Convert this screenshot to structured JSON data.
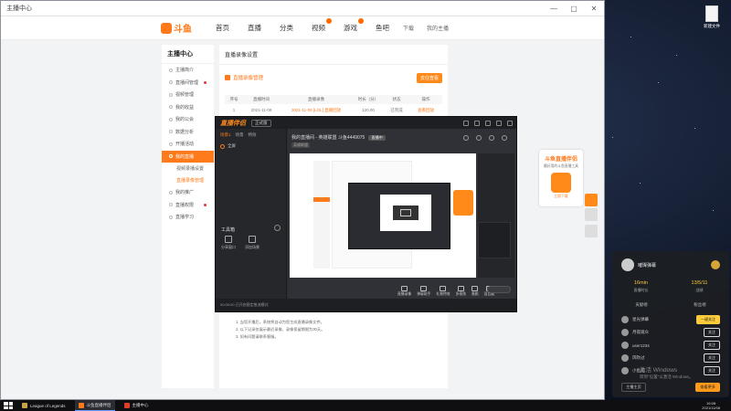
{
  "browser": {
    "title": "主播中心"
  },
  "site": {
    "logo": "斗鱼",
    "nav": [
      "首页",
      "直播",
      "分类",
      "视频",
      "游戏",
      "鱼吧"
    ],
    "header_right": [
      "下载",
      "我的主播"
    ]
  },
  "sidebar": {
    "title": "主播中心",
    "items": [
      "主播简介",
      "直播间管理",
      "视频管理",
      "我的收益",
      "我的公会",
      "数据分析",
      "开播活动",
      "我的直播"
    ],
    "subitems": [
      "视频录播设置",
      "直播录像管理"
    ],
    "items_after": [
      "我的推广",
      "直播权限",
      "直播学习"
    ]
  },
  "main": {
    "title": "直播录像设置",
    "tag": "直播录像管理",
    "action": "去往查看",
    "columns": [
      "序号",
      "直播时间",
      "直播录像",
      "时长（分）",
      "状态",
      "操作"
    ],
    "rows": [
      {
        "idx": "1",
        "time": "2021-11-08",
        "title": "2021-11-08 [LOL] 直播回放",
        "duration": "120.00",
        "status": "已完成",
        "op": "查看回放"
      }
    ],
    "notes": [
      "1. 当您开播后，系统将自动为您生成直播录像文件。",
      "2. 以下记录仅展示最近录像，录像保留期限为30天。",
      "3. 如有问题请联系客服。"
    ]
  },
  "app": {
    "brand": "直播伴侣",
    "version": "正式版",
    "tabs": [
      "场景1",
      "场景",
      "特效"
    ],
    "scene": "全屏",
    "layer_label": "工具箱",
    "source_buttons": [
      "分享窗口",
      "添加场景"
    ],
    "room_title": "我的直播间 - 英雄联盟 斗鱼4449075",
    "room_tag": "直播中",
    "room_sub_tag": "英雄联盟",
    "tools": [
      "直播录像",
      "弹幕助手",
      "礼物特效",
      "多视角",
      "美颜",
      "混音器"
    ],
    "status": "00:00:00 已开启稳定推流模式"
  },
  "ad": {
    "title": "斗鱼直播伴侣",
    "subtitle": "最好用的斗鱼直播工具",
    "cta": "立即下载"
  },
  "chat": {
    "name": "璀璨弹幕",
    "stats": [
      {
        "value": "16min",
        "label": "直播时长"
      },
      {
        "value": "13/5/11",
        "label": "战绩"
      }
    ],
    "tabs": [
      "贡献榜",
      "粉丝榜"
    ],
    "users": [
      {
        "name": "星光弹幕",
        "score": "",
        "btn": "一键关注",
        "hot": true
      },
      {
        "name": "月夜观众",
        "score": "",
        "btn": "关注",
        "hot": false
      },
      {
        "name": "user1234",
        "score": "",
        "btn": "关注",
        "hot": false
      },
      {
        "name": "风吹过",
        "score": "",
        "btn": "关注",
        "hot": false
      },
      {
        "name": "小鱼儿",
        "score": "",
        "btn": "关注",
        "hot": false
      }
    ],
    "footer": [
      "主播主页",
      "查看更多"
    ]
  },
  "desktop": {
    "icons": [
      "斗鱼",
      "新建文件"
    ],
    "overlay_logo": "斗鱼",
    "overlay_number": "4449075"
  },
  "watermark": {
    "title": "激活 Windows",
    "sub": "转到\"设置\"以激活 Windows。"
  },
  "taskbar": {
    "tasks": [
      {
        "label": "League of Legends",
        "color": "#c8a24a"
      },
      {
        "label": "斗鱼直播伴侣",
        "color": "#ff7a1a"
      },
      {
        "label": "主播中心",
        "color": "#e23c2e"
      }
    ],
    "time": "16:08",
    "date": "2021/11/08"
  }
}
